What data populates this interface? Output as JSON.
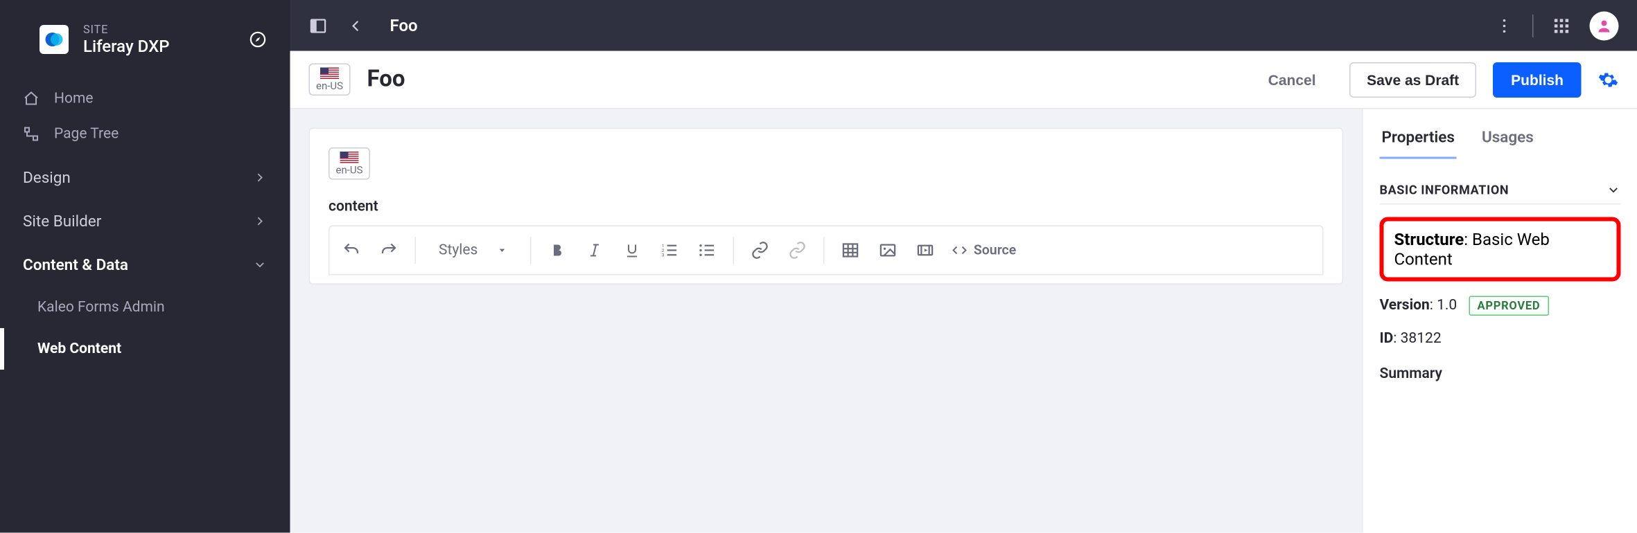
{
  "site": {
    "label": "SITE",
    "name": "Liferay DXP"
  },
  "sidebar": {
    "home": "Home",
    "page_tree": "Page Tree",
    "groups": [
      {
        "label": "Design",
        "expanded": false
      },
      {
        "label": "Site Builder",
        "expanded": false
      },
      {
        "label": "Content & Data",
        "expanded": true,
        "items": [
          {
            "label": "Kaleo Forms Admin",
            "active": false
          },
          {
            "label": "Web Content",
            "active": true
          }
        ]
      }
    ]
  },
  "topbar": {
    "title": "Foo"
  },
  "actionbar": {
    "locale": "en-US",
    "title": "Foo",
    "cancel": "Cancel",
    "save_draft": "Save as Draft",
    "publish": "Publish"
  },
  "editor": {
    "locale": "en-US",
    "content_label": "content",
    "styles_label": "Styles",
    "source_label": "Source"
  },
  "panel": {
    "tabs": {
      "properties": "Properties",
      "usages": "Usages"
    },
    "section": "BASIC INFORMATION",
    "structure_key": "Structure",
    "structure_value": "Basic Web Content",
    "version_key": "Version",
    "version_value": "1.0",
    "status": "APPROVED",
    "id_key": "ID",
    "id_value": "38122",
    "summary": "Summary"
  }
}
